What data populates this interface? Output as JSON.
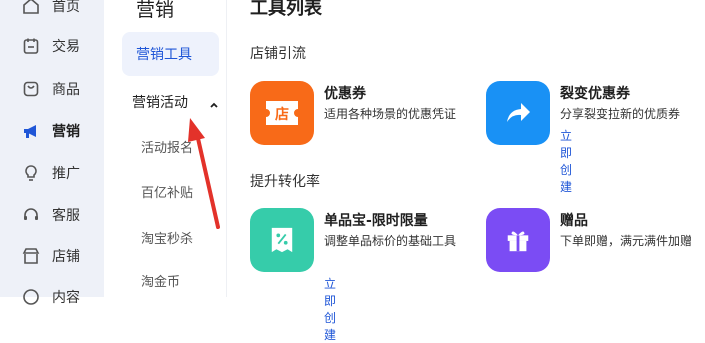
{
  "colors": {
    "accent": "#1f56d7",
    "orange": "#f86a18",
    "blue": "#1991f5",
    "green": "#36ccaa",
    "purple": "#7b4cf4",
    "annotation_arrow": "#e3322a"
  },
  "rail": {
    "items": [
      {
        "label": "首页",
        "icon": "home-icon"
      },
      {
        "label": "交易",
        "icon": "trade-icon"
      },
      {
        "label": "商品",
        "icon": "goods-icon"
      },
      {
        "label": "营销",
        "icon": "megaphone-icon",
        "active": true
      },
      {
        "label": "推广",
        "icon": "bulb-icon"
      },
      {
        "label": "客服",
        "icon": "headset-icon"
      },
      {
        "label": "店铺",
        "icon": "store-icon"
      },
      {
        "label": "内容",
        "icon": "content-icon"
      }
    ]
  },
  "column2": {
    "title": "营销",
    "tool_button": "营销工具",
    "activities_label": "营销活动",
    "sub_items": [
      "活动报名",
      "百亿补贴",
      "淘宝秒杀",
      "淘金币"
    ]
  },
  "main": {
    "title": "工具列表",
    "sections": [
      {
        "title": "店铺引流"
      },
      {
        "title": "提升转化率"
      }
    ],
    "cards": [
      {
        "title": "优惠券",
        "desc": "适用各种场景的优惠凭证",
        "link": "",
        "icon": "coupon-store-icon",
        "icon_text": "店"
      },
      {
        "title": "裂变优惠券",
        "desc": "分享裂变拉新的优质券",
        "link": "立即创建",
        "icon": "share-arrow-icon"
      },
      {
        "title": "单品宝-限时限量",
        "desc": "调整单品标价的基础工具",
        "link": "立即创建",
        "icon": "discount-tag-icon"
      },
      {
        "title": "赠品",
        "desc": "下单即赠，满元满件加赠",
        "link": "",
        "icon": "gift-icon"
      }
    ]
  }
}
